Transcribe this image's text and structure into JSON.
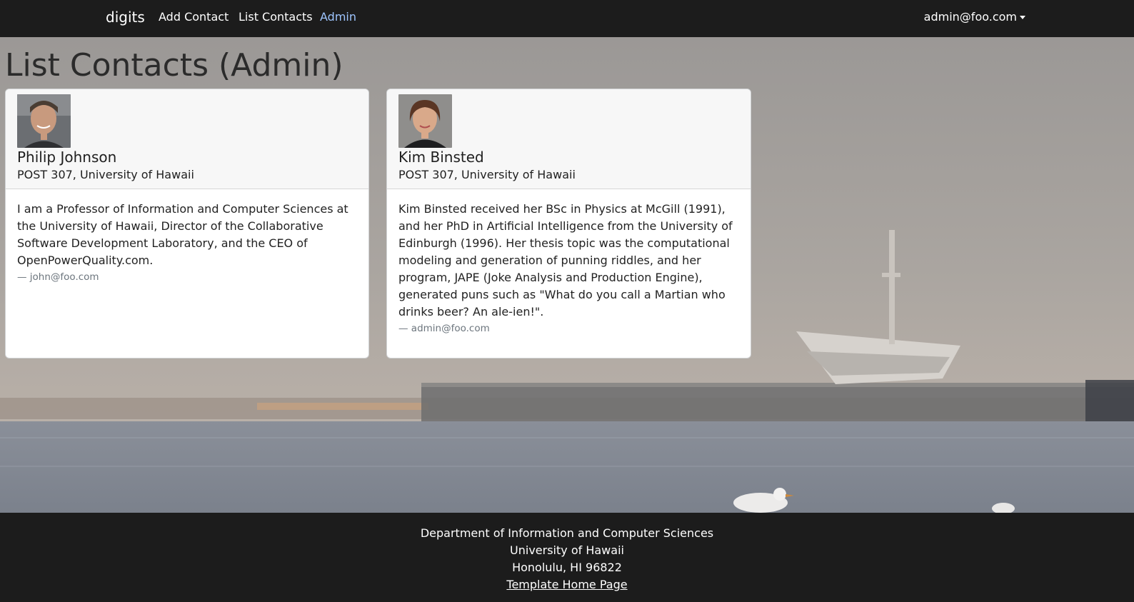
{
  "navbar": {
    "brand": "digits",
    "links": [
      {
        "label": "Add Contact"
      },
      {
        "label": "List Contacts"
      },
      {
        "label": "Admin"
      }
    ],
    "user_menu": "admin@foo.com"
  },
  "page": {
    "title": "List Contacts (Admin)"
  },
  "contacts": [
    {
      "name": "Philip Johnson",
      "address": "POST 307, University of Hawaii",
      "description": "I am a Professor of Information and Computer Sciences at the University of Hawaii, Director of the Collaborative Software Development Laboratory, and the CEO of OpenPowerQuality.com.",
      "owner": "— john@foo.com"
    },
    {
      "name": "Kim Binsted",
      "address": "POST 307, University of Hawaii",
      "description": "Kim Binsted received her BSc in Physics at McGill (1991), and her PhD in Artificial Intelligence from the University of Edinburgh (1996). Her thesis topic was the computational modeling and generation of punning riddles, and her program, JAPE (Joke Analysis and Production Engine), generated puns such as \"What do you call a Martian who drinks beer? An ale-ien!\".",
      "owner": "— admin@foo.com"
    }
  ],
  "footer": {
    "line1": "Department of Information and Computer Sciences",
    "line2": "University of Hawaii",
    "line3": "Honolulu, HI 96822",
    "link": "Template Home Page"
  },
  "colors": {
    "navbar_bg": "#1c1c1c",
    "active_link": "#9ec5fe",
    "card_header_bg": "#f7f7f7"
  }
}
